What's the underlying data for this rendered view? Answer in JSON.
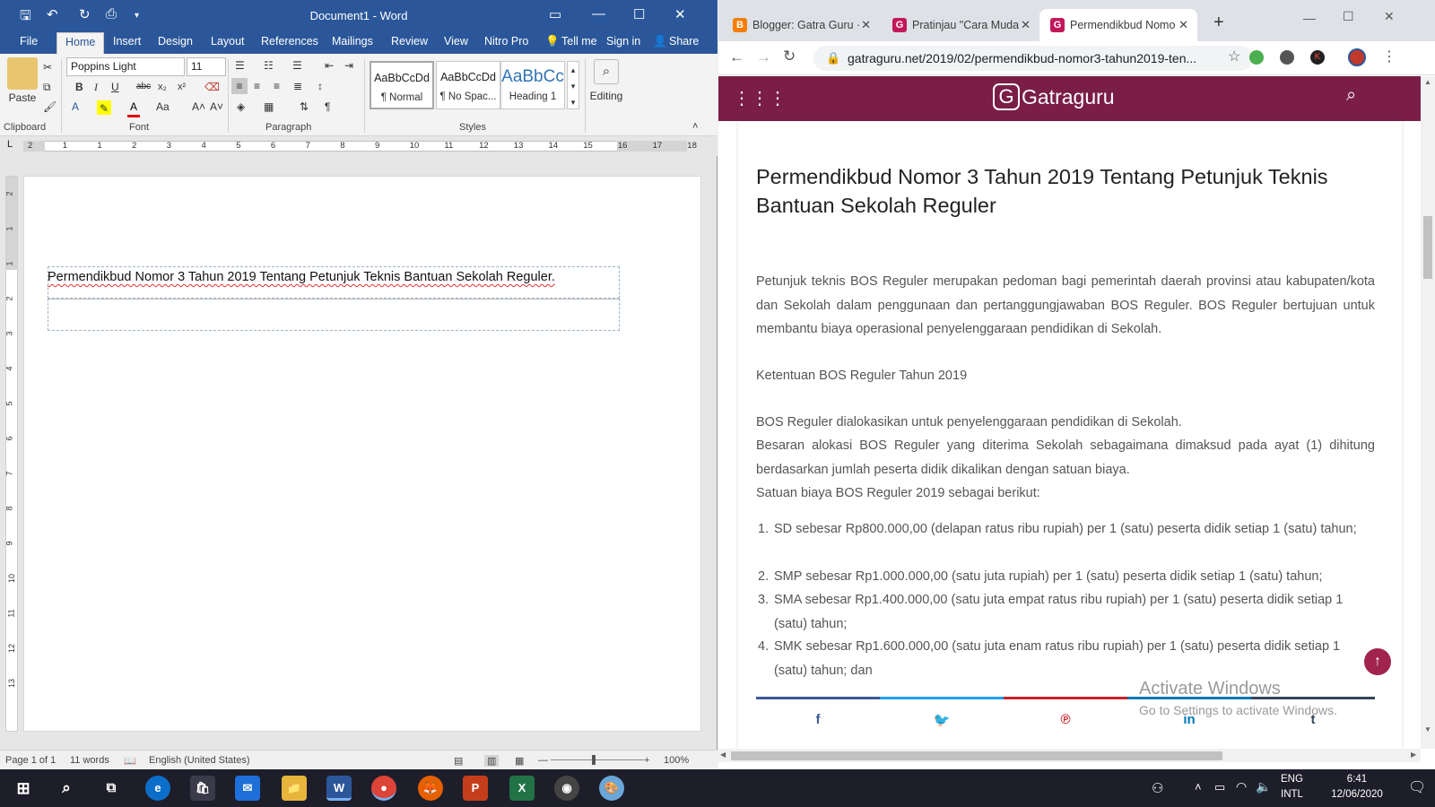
{
  "word": {
    "title": "Document1 - Word",
    "tabs": [
      "File",
      "Home",
      "Insert",
      "Design",
      "Layout",
      "References",
      "Mailings",
      "Review",
      "View",
      "Nitro Pro"
    ],
    "tell_me": "Tell me",
    "sign_in": "Sign in",
    "share": "Share",
    "clipboard": {
      "paste": "Paste",
      "label": "Clipboard"
    },
    "font": {
      "name": "Poppins Light",
      "size": "11",
      "label": "Font"
    },
    "paragraph_label": "Paragraph",
    "styles": {
      "label": "Styles",
      "items": [
        {
          "preview": "AaBbCcDd",
          "name": "¶ Normal"
        },
        {
          "preview": "AaBbCcDd",
          "name": "¶ No Spac..."
        },
        {
          "preview": "AaBbCc",
          "name": "Heading 1"
        }
      ]
    },
    "editing": "Editing",
    "ruler_marks": [
      "2",
      "1",
      "1",
      "2",
      "3",
      "4",
      "5",
      "6",
      "7",
      "8",
      "9",
      "10",
      "11",
      "12",
      "13",
      "14",
      "15",
      "16",
      "17",
      "18"
    ],
    "vruler_marks": [
      "2",
      "1",
      "1",
      "2",
      "3",
      "4",
      "5",
      "6",
      "7",
      "8",
      "9",
      "10",
      "11",
      "12",
      "13"
    ],
    "document_text": "Permendikbud Nomor 3 Tahun 2019 Tentang Petunjuk Teknis Bantuan Sekolah Reguler.",
    "status": {
      "page": "Page 1 of 1",
      "words": "11 words",
      "language": "English (United States)",
      "zoom": "100%"
    }
  },
  "chrome": {
    "tabs": [
      {
        "title": "Blogger: Gatra Guru ·",
        "favicon": "B",
        "color": "#f57d00"
      },
      {
        "title": "Pratinjau \"Cara Muda",
        "favicon": "G",
        "color": "#c2185b"
      },
      {
        "title": "Permendikbud Nomo",
        "favicon": "G",
        "color": "#c2185b"
      }
    ],
    "url": "gatraguru.net/2019/02/permendikbud-nomor3-tahun2019-ten...",
    "site_logo": "Gatraguru",
    "article": {
      "title": "Permendikbud Nomor 3 Tahun 2019 Tentang Petunjuk Teknis Bantuan Sekolah Reguler",
      "intro": "Petunjuk teknis BOS Reguler merupakan pedoman bagi pemerintah daerah provinsi atau kabupaten/kota dan Sekolah dalam penggunaan dan pertanggungjawaban BOS Reguler. BOS Reguler bertujuan untuk membantu biaya operasional penyelenggaraan pendidikan di Sekolah.",
      "heading": "Ketentuan BOS Reguler Tahun 2019",
      "p1": "BOS Reguler dialokasikan untuk penyelenggaraan pendidikan di Sekolah.",
      "p2": "Besaran alokasi BOS Reguler yang diterima Sekolah sebagaimana dimaksud pada ayat (1) dihitung berdasarkan jumlah peserta didik dikalikan dengan satuan biaya.",
      "p3": "Satuan biaya BOS Reguler 2019 sebagai berikut:",
      "list": [
        "SD sebesar Rp800.000,00 (delapan ratus ribu rupiah) per 1 (satu) peserta didik setiap 1 (satu) tahun;",
        "SMP sebesar Rp1.000.000,00 (satu juta rupiah) per 1 (satu) peserta didik setiap 1 (satu) tahun;",
        "SMA sebesar Rp1.400.000,00 (satu juta empat ratus ribu rupiah) per 1 (satu) peserta didik setiap 1 (satu) tahun;",
        "SMK sebesar Rp1.600.000,00 (satu juta enam ratus ribu rupiah) per 1 (satu) peserta didik setiap 1 (satu) tahun; dan"
      ]
    },
    "share_colors": [
      "#3b5998",
      "#1da1f2",
      "#cb2027",
      "#0077b5",
      "#35465c"
    ]
  },
  "watermark": {
    "line1": "Activate Windows",
    "line2": "Go to Settings to activate Windows."
  },
  "taskbar": {
    "lang1": "ENG",
    "lang2": "INTL",
    "time": "6:41",
    "date": "12/06/2020"
  }
}
